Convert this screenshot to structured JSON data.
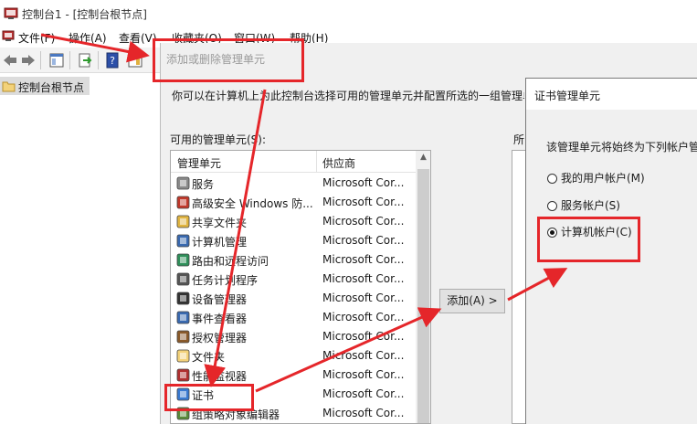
{
  "window": {
    "title": "控制台1 - [控制台根节点]"
  },
  "menu": {
    "items": [
      "文件(F)",
      "操作(A)",
      "查看(V)",
      "收藏夹(O)",
      "窗口(W)",
      "帮助(H)"
    ]
  },
  "tree": {
    "root_label": "控制台根节点"
  },
  "dialog": {
    "title": "添加或删除管理单元",
    "description": "你可以在计算机上为此控制台选择可用的管理单元并配置所选的一组管理单元。",
    "available_label": "可用的管理单元(S):",
    "selected_label": "所",
    "columns": [
      "管理单元",
      "供应商"
    ],
    "rows": [
      {
        "name": "服务",
        "vendor": "Microsoft Cor...",
        "icon": "services-gear-icon"
      },
      {
        "name": "高级安全 Windows 防...",
        "vendor": "Microsoft Cor...",
        "icon": "firewall-icon"
      },
      {
        "name": "共享文件夹",
        "vendor": "Microsoft Cor...",
        "icon": "shared-folder-icon"
      },
      {
        "name": "计算机管理",
        "vendor": "Microsoft Cor...",
        "icon": "computer-management-icon"
      },
      {
        "name": "路由和远程访问",
        "vendor": "Microsoft Cor...",
        "icon": "routing-globe-icon"
      },
      {
        "name": "任务计划程序",
        "vendor": "Microsoft Cor...",
        "icon": "clock-icon"
      },
      {
        "name": "设备管理器",
        "vendor": "Microsoft Cor...",
        "icon": "device-manager-icon"
      },
      {
        "name": "事件查看器",
        "vendor": "Microsoft Cor...",
        "icon": "event-viewer-icon"
      },
      {
        "name": "授权管理器",
        "vendor": "Microsoft Cor...",
        "icon": "authorization-icon"
      },
      {
        "name": "文件夹",
        "vendor": "Microsoft Cor...",
        "icon": "folder-icon"
      },
      {
        "name": "性能监视器",
        "vendor": "Microsoft Cor...",
        "icon": "performance-monitor-icon"
      },
      {
        "name": "证书",
        "vendor": "Microsoft Cor...",
        "icon": "certificate-icon"
      },
      {
        "name": "组策略对象编辑器",
        "vendor": "Microsoft Cor...",
        "icon": "group-policy-icon"
      }
    ],
    "add_button": "添加(A) >"
  },
  "cert_dialog": {
    "title": "证书管理单元",
    "description": "该管理单元将始终为下列帐户管理证书:",
    "options": [
      {
        "label": "我的用户帐户(M)",
        "checked": false
      },
      {
        "label": "服务帐户(S)",
        "checked": false
      },
      {
        "label": "计算机帐户(C)",
        "checked": true
      }
    ]
  },
  "colors": {
    "annotation": "#e5262a",
    "dialog_bg": "#f0f0f0"
  }
}
